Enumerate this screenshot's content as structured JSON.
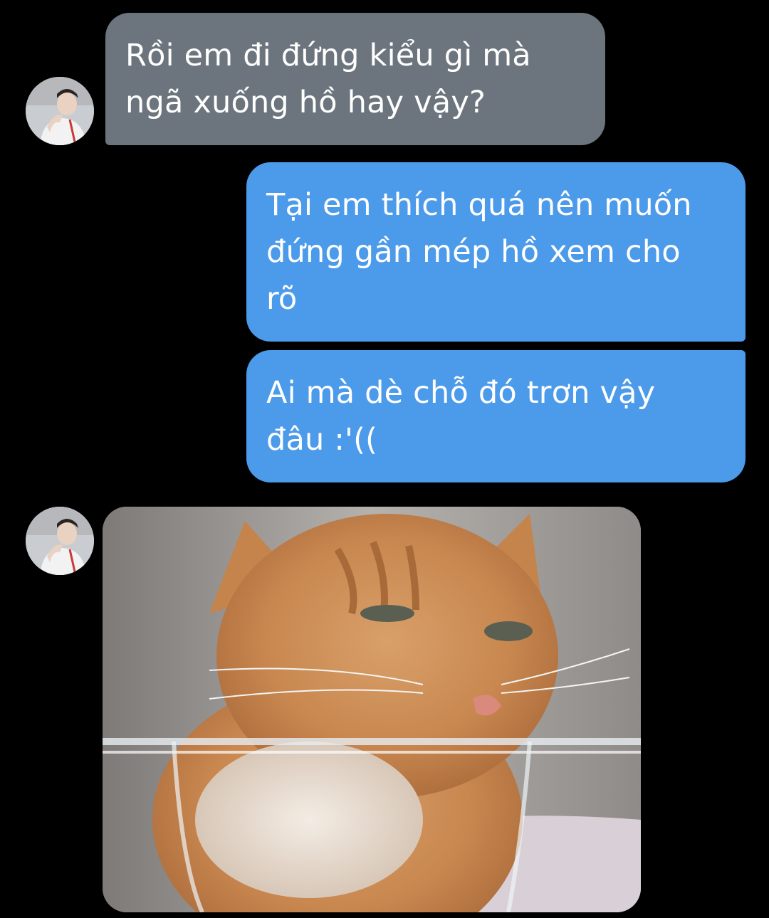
{
  "conversation": {
    "messages": [
      {
        "direction": "incoming",
        "text": "Rồi em đi đứng kiểu gì mà\nngã xuống hồ hay vậy?"
      },
      {
        "direction": "outgoing",
        "text": "Tại em thích quá nên muốn\nđứng gần mép hồ xem cho\nrõ"
      },
      {
        "direction": "outgoing",
        "text": "Ai mà dè chỗ đó trơn vậy\nđâu :'(("
      },
      {
        "direction": "incoming",
        "type": "image",
        "image_description": "crying-orange-cat-meme"
      }
    ]
  },
  "colors": {
    "background": "#000000",
    "incoming_bubble": "#6c757d",
    "outgoing_bubble": "#4c9aea",
    "text": "#ffffff"
  },
  "icons": {
    "avatar": "contact-avatar"
  }
}
